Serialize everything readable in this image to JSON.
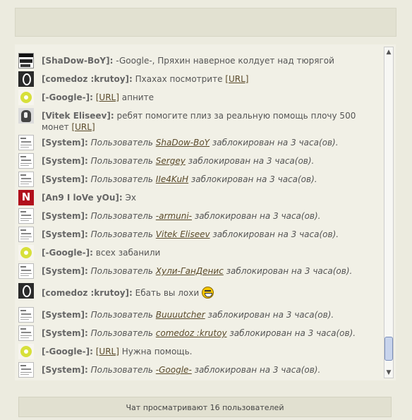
{
  "footer": {
    "viewers_text": "Чат просматривают 16 пользователей"
  },
  "messages": [
    {
      "avatar": "shadow-boy-avatar",
      "user": "[ShaDow-BoY]:",
      "text": "-Google-, Пряхин наверное колдует над тюрягой"
    },
    {
      "avatar": "dark-ring-avatar",
      "user": "[comedoz :krutoy]:",
      "text": "Пхахах посмотрите",
      "link": "[URL]"
    },
    {
      "avatar": "google-ring-avatar",
      "user": "[-Google-]:",
      "link": "[URL]",
      "after": "апните"
    },
    {
      "avatar": "vitek-avatar",
      "user": "[Vitek Eliseev]:",
      "text": "ребят помогите плиз за реальную помощь плочу 500 монет",
      "link": "[URL]"
    },
    {
      "avatar": "no-avatar",
      "user": "[System]:",
      "pre": "Пользователь",
      "target": "ShaDow-BoY",
      "post": "заблокирован на 3 часа(ов)."
    },
    {
      "avatar": "no-avatar",
      "user": "[System]:",
      "pre": "Пользователь",
      "target": "Sergey",
      "post": "заблокирован на 3 часа(ов)."
    },
    {
      "avatar": "no-avatar",
      "user": "[System]:",
      "pre": "Пользователь",
      "target": "IIe4KuH",
      "post": "заблокирован на 3 часа(ов)."
    },
    {
      "avatar": "an9-avatar",
      "user": "[An9 I loVe yOu]:",
      "text": "Эх"
    },
    {
      "avatar": "no-avatar",
      "user": "[System]:",
      "pre": "Пользователь",
      "target": "-armuni-",
      "post": "заблокирован на 3 часа(ов)."
    },
    {
      "avatar": "no-avatar",
      "user": "[System]:",
      "pre": "Пользователь",
      "target": "Vitek Eliseev",
      "post": "заблокирован на 3 часа(ов)."
    },
    {
      "avatar": "google-ring-avatar",
      "user": "[-Google-]:",
      "text": "всех забанили"
    },
    {
      "avatar": "no-avatar",
      "user": "[System]:",
      "pre": "Пользователь",
      "target": "Хули-ГанДенис",
      "post": "заблокирован на 3 часа(ов)."
    },
    {
      "avatar": "dark-ring-avatar",
      "user": "[comedoz :krutoy]:",
      "text": "Ебать вы лохи"
    },
    {
      "avatar": "no-avatar",
      "user": "[System]:",
      "pre": "Пользователь",
      "target": "Buuuutcher",
      "post": "заблокирован на 3 часа(ов)."
    },
    {
      "avatar": "no-avatar",
      "user": "[System]:",
      "pre": "Пользователь",
      "target": "comedoz :krutoy",
      "post": "заблокирован на 3 часа(ов)."
    },
    {
      "avatar": "google-ring-avatar",
      "user": "[-Google-]:",
      "link": "[URL]",
      "after": "Нужна помощь."
    },
    {
      "avatar": "no-avatar",
      "user": "[System]:",
      "pre": "Пользователь",
      "target": "-Google-",
      "post": "заблокирован на 3 часа(ов)."
    }
  ],
  "scrollbar": {
    "up_glyph": "▲",
    "down_glyph": "▼"
  }
}
